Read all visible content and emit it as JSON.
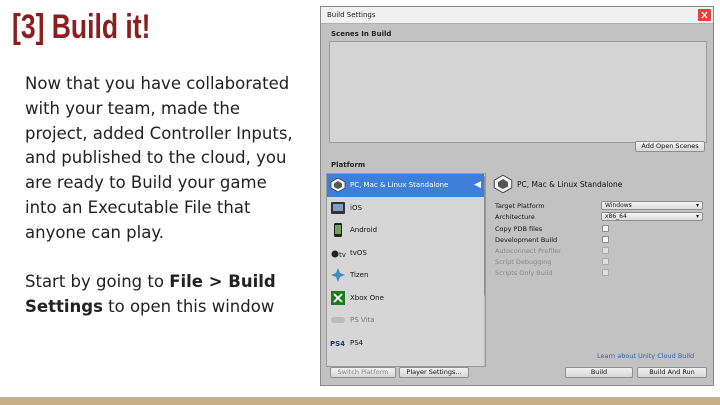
{
  "slide": {
    "title": "[3] Build it!",
    "paragraph1": "Now that you have collaborated with your team, made the project, added Controller Inputs, and published to the cloud, you are ready to Build your game into an Executable File that anyone can play.",
    "p2_prefix": "Start by going to ",
    "p2_bold1": "File > Build Settings",
    "p2_suffix": " to open this window"
  },
  "window": {
    "title": "Build Settings",
    "scenes_label": "Scenes In Build",
    "add_open_scenes": "Add Open Scenes",
    "platform_label": "Platform",
    "platforms": [
      {
        "label": "PC, Mac & Linux Standalone",
        "icon": "unity-standalone-icon",
        "selected": true
      },
      {
        "label": "iOS",
        "icon": "ios-icon"
      },
      {
        "label": "Android",
        "icon": "android-icon"
      },
      {
        "label": "tvOS",
        "icon": "tvos-icon"
      },
      {
        "label": "Tizen",
        "icon": "tizen-icon"
      },
      {
        "label": "Xbox One",
        "icon": "xbox-icon"
      },
      {
        "label": "PS Vita",
        "icon": "psvita-icon",
        "disabled": true
      },
      {
        "label": "PS4",
        "icon": "ps4-icon"
      }
    ],
    "selected_platform_title": "PC, Mac & Linux Standalone",
    "settings": {
      "target_platform_label": "Target Platform",
      "target_platform_value": "Windows",
      "architecture_label": "Architecture",
      "architecture_value": "x86_64",
      "copy_pdb_label": "Copy PDB files",
      "dev_build_label": "Development Build",
      "autoconnect_label": "Autoconnect Profiler",
      "script_debug_label": "Script Debugging",
      "scripts_only_label": "Scripts Only Build"
    },
    "cloud_link": "Learn about Unity Cloud Build",
    "buttons": {
      "switch_platform": "Switch Platform",
      "player_settings": "Player Settings...",
      "build": "Build",
      "build_and_run": "Build And Run"
    }
  },
  "colors": {
    "title": "#8b1e1e",
    "selection": "#3d7fd9",
    "close": "#d9463c",
    "bottom_bar": "#c8b088"
  }
}
